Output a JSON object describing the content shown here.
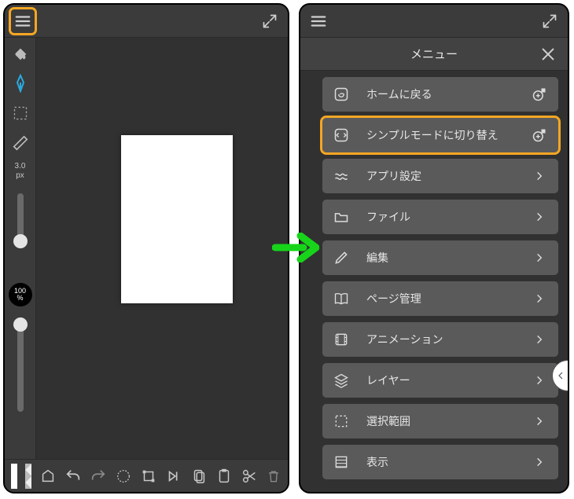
{
  "left": {
    "brush_size": "3.0",
    "brush_unit": "px",
    "zoom_value": "100",
    "zoom_unit": "%"
  },
  "menu": {
    "title": "メニュー",
    "items": [
      {
        "label": "ホームに戻る",
        "trailing": "add"
      },
      {
        "label": "シンプルモードに切り替え",
        "trailing": "add"
      },
      {
        "label": "アプリ設定",
        "trailing": "chevron"
      },
      {
        "label": "ファイル",
        "trailing": "chevron"
      },
      {
        "label": "編集",
        "trailing": "chevron"
      },
      {
        "label": "ページ管理",
        "trailing": "chevron"
      },
      {
        "label": "アニメーション",
        "trailing": "chevron"
      },
      {
        "label": "レイヤー",
        "trailing": "chevron"
      },
      {
        "label": "選択範囲",
        "trailing": "chevron"
      },
      {
        "label": "表示",
        "trailing": "chevron"
      }
    ]
  }
}
